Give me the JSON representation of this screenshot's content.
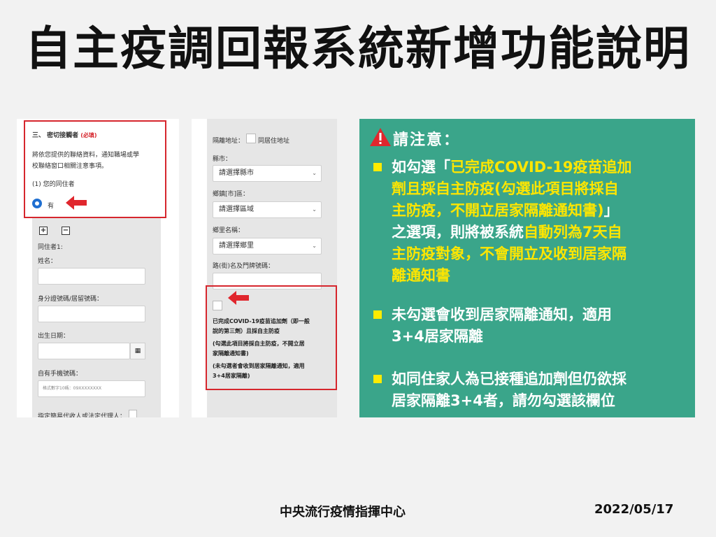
{
  "title": "自主疫調回報系統新增功能說明",
  "panel1": {
    "section_heading": "三、 密切接觸者",
    "required": "(必填)",
    "desc_line1": "將依您提供的聯絡資料，通知職場或學",
    "desc_line2": "校聯絡窗口相關注意事項。",
    "question": "(1) 您的同住者",
    "radio_yes": "有",
    "add_symbol": "+",
    "remove_symbol": "−",
    "cohabitant_label": "同住者1:",
    "name_label": "姓名：",
    "id_label": "身分證號碼/居留號碼：",
    "dob_label": "出生日期：",
    "phone_label": "自有手機號碼：",
    "phone_placeholder": "格式數字10碼：09XXXXXXXX",
    "proxy_label": "指定簡易代收人或法定代理人："
  },
  "panel2": {
    "quarantine_addr_label": "隔離地址：",
    "same_addr_label": "同居住地址",
    "county_label": "縣市：",
    "county_select": "請選擇縣市",
    "district_label": "鄉鎮[市]區：",
    "district_select": "請選擇區域",
    "village_label": "鄉里名稱：",
    "village_select": "請選擇鄉里",
    "road_label": "路(街)名及門牌號碼：",
    "booster_line1": "已完成COVID-19疫苗追加劑（即一般",
    "booster_line2": "說的第三劑）且採自主防疫",
    "booster_line3": "(勾選此項目將採自主防疫，不開立居",
    "booster_line4": "家隔離通知書)",
    "booster_line5": "(未勾選者會收到居家隔離通知，適用",
    "booster_line6": "3+4居家隔離)"
  },
  "notice": {
    "title": "請注意：",
    "p1_l1a": "如勾選「",
    "p1_l1b": "已完成COVID-19疫苗追加",
    "p1_l2": "劑且採自主防疫(勾選此項目將採自",
    "p1_l3a": "主防疫，不開立居家隔離通知書)",
    "p1_l3b": "」",
    "p1_l4a": "之選項，則將被系統",
    "p1_l4b": "自動列為7天自",
    "p1_l5": "主防疫對象，不會開立及收到居家隔",
    "p1_l6": "離通知書",
    "p2_l1": "未勾選會收到居家隔離通知，適用",
    "p2_l2": "3+4居家隔離",
    "p3_l1": "如同住家人為已接種追加劑但仍欲採",
    "p3_l2": "居家隔離3+4者，請勿勾選該欄位"
  },
  "footer": {
    "org": "中央流行疫情指揮中心",
    "date": "2022/05/17"
  },
  "colors": {
    "accent_red": "#d6262d",
    "notice_bg": "#3aa58a",
    "highlight_yellow": "#ffe600",
    "radio_blue": "#1f6fd1"
  }
}
